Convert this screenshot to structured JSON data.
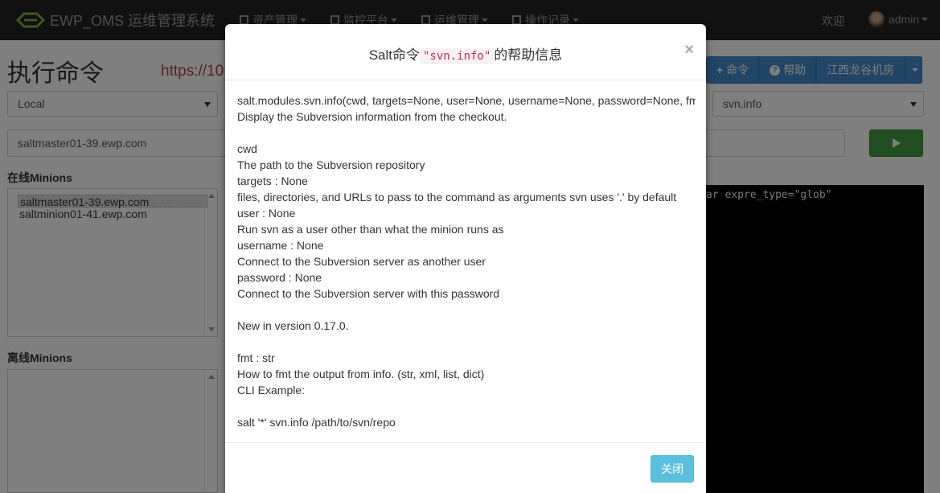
{
  "navbar": {
    "brand": "EWP_OMS 运维管理系统",
    "menus": [
      {
        "label": "资产管理",
        "icon": "list-icon"
      },
      {
        "label": "监控平台",
        "icon": "bar-chart-icon"
      },
      {
        "label": "运维管理",
        "icon": "list-icon"
      },
      {
        "label": "操作记录",
        "icon": "bar-chart-icon"
      }
    ],
    "welcome": "欢迎",
    "username": "admin"
  },
  "page": {
    "title": "执行命令",
    "url_hint": "https://10",
    "target_select": "Local",
    "function_select": "svn.info",
    "host_input": "saltmaster01-39.ewp.com",
    "online_label": "在线Minions",
    "online_minions": [
      "saltmaster01-39.ewp.com",
      "saltminion01-41.ewp.com"
    ],
    "offline_label": "离线Minions",
    "btn_command": "命令",
    "btn_help": "帮助",
    "btn_datacenter": "江西龙谷机房",
    "terminal_text": "ar expre_type=\"glob\""
  },
  "modal": {
    "title_prefix": "Salt命令",
    "title_code": "\"svn.info\"",
    "title_suffix": "的帮助信息",
    "close_x": "×",
    "body_lines": [
      "salt.modules.svn.info(cwd, targets=None, user=None, username=None, password=None, fmt='str')",
      "Display the Subversion information from the checkout.",
      "",
      "cwd",
      "The path to the Subversion repository",
      "targets : None",
      "files, directories, and URLs to pass to the command as arguments svn uses '.' by default",
      "user : None",
      "Run svn as a user other than what the minion runs as",
      "username : None",
      "Connect to the Subversion server as another user",
      "password : None",
      "Connect to the Subversion server with this password",
      "",
      "New in version 0.17.0.",
      "",
      "fmt : str",
      "How to fmt the output from info. (str, xml, list, dict)",
      "CLI Example:",
      "",
      "salt '*' svn.info /path/to/svn/repo"
    ],
    "close_button": "关闭"
  }
}
